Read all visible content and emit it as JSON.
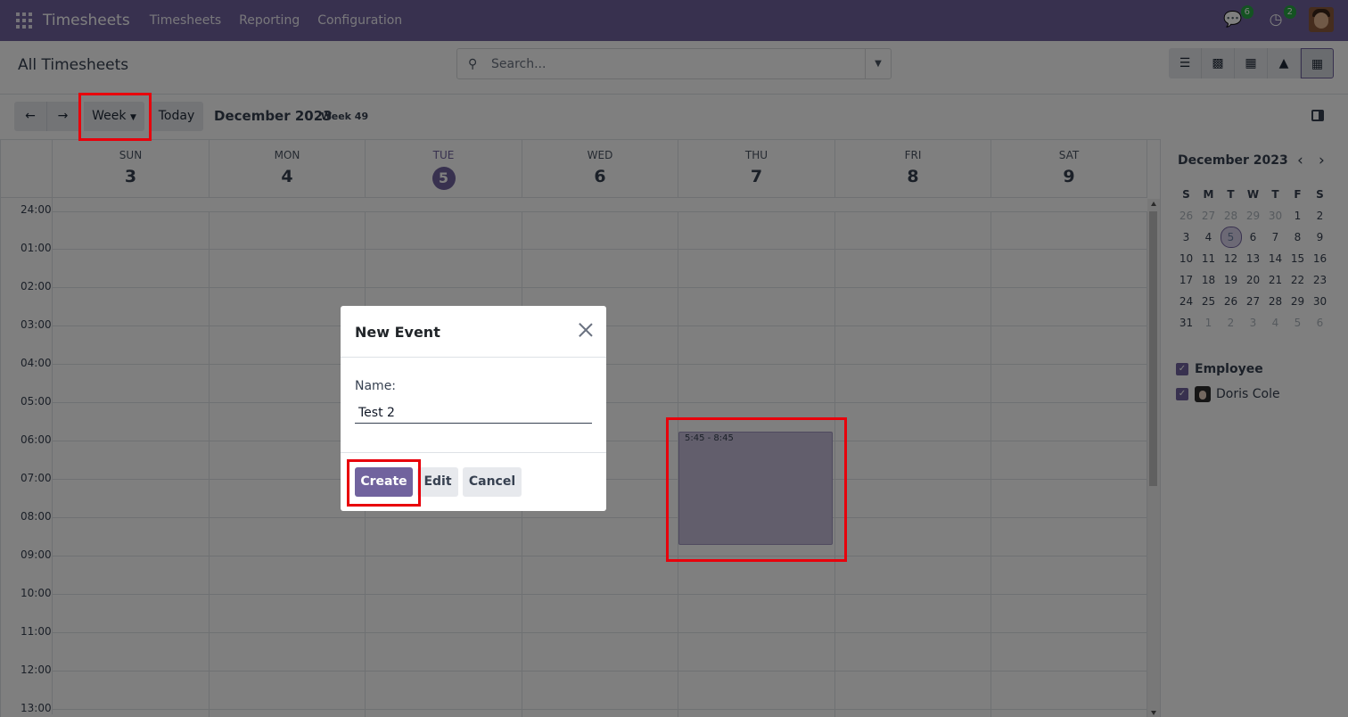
{
  "navbar": {
    "brand": "Timesheets",
    "menu": [
      "Timesheets",
      "Reporting",
      "Configuration"
    ],
    "messages_count": "6",
    "activities_count": "2"
  },
  "control_panel": {
    "breadcrumb": "All Timesheets",
    "search_placeholder": "Search...",
    "views": [
      "list-icon",
      "kanban-icon",
      "pivot-icon",
      "graph-icon",
      "calendar-icon"
    ]
  },
  "toolbar": {
    "scale": "Week",
    "today": "Today",
    "month_title": "December 2023",
    "week_label": "Week 49"
  },
  "calendar": {
    "days": [
      {
        "name": "SUN",
        "num": "3"
      },
      {
        "name": "MON",
        "num": "4"
      },
      {
        "name": "TUE",
        "num": "5"
      },
      {
        "name": "WED",
        "num": "6"
      },
      {
        "name": "THU",
        "num": "7"
      },
      {
        "name": "FRI",
        "num": "8"
      },
      {
        "name": "SAT",
        "num": "9"
      }
    ],
    "hours": [
      "24:00",
      "01:00",
      "02:00",
      "03:00",
      "04:00",
      "05:00",
      "06:00",
      "07:00",
      "08:00",
      "09:00",
      "10:00",
      "11:00",
      "12:00",
      "13:00"
    ],
    "event_time": "5:45 - 8:45"
  },
  "side_panel": {
    "mini_title": "December 2023",
    "weekday_heads": [
      "S",
      "M",
      "T",
      "W",
      "T",
      "F",
      "S"
    ],
    "weeks": [
      [
        "26",
        "27",
        "28",
        "29",
        "30",
        "1",
        "2"
      ],
      [
        "3",
        "4",
        "5",
        "6",
        "7",
        "8",
        "9"
      ],
      [
        "10",
        "11",
        "12",
        "13",
        "14",
        "15",
        "16"
      ],
      [
        "17",
        "18",
        "19",
        "20",
        "21",
        "22",
        "23"
      ],
      [
        "24",
        "25",
        "26",
        "27",
        "28",
        "29",
        "30"
      ],
      [
        "31",
        "1",
        "2",
        "3",
        "4",
        "5",
        "6"
      ]
    ],
    "filter_group": "Employee",
    "filter_employee": "Doris Cole"
  },
  "dialog": {
    "title": "New Event",
    "name_label": "Name:",
    "name_value": "Test 2",
    "create": "Create",
    "edit": "Edit",
    "cancel": "Cancel"
  },
  "colors": {
    "brand": "#71639e",
    "highlight": "#e8000b"
  }
}
